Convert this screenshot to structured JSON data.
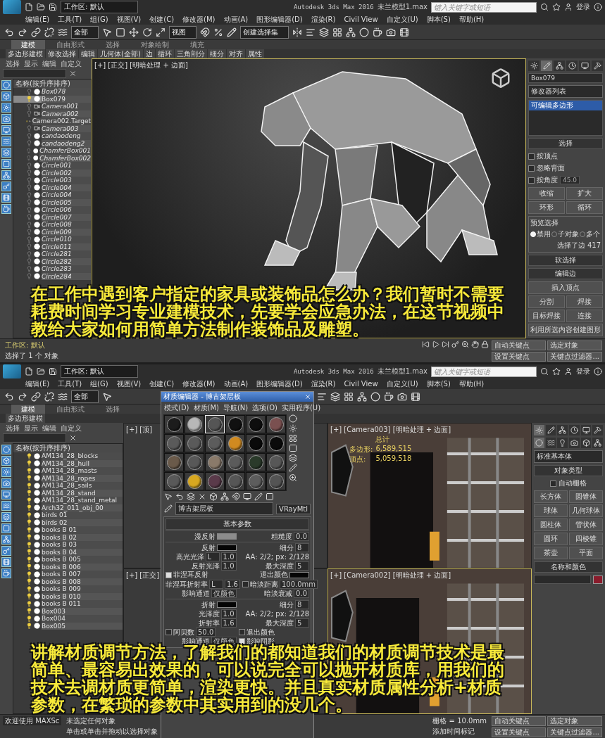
{
  "top": {
    "app": {
      "workspace": "工作区: 默认",
      "title": "Autodesk 3ds Max 2016",
      "file": "未兰模型1.max",
      "search_placeholder": "键入关键字或短语",
      "login": "登录"
    },
    "menu": [
      "编辑(E)",
      "工具(T)",
      "组(G)",
      "视图(V)",
      "创建(C)",
      "修改器(M)",
      "动画(A)",
      "图形编辑器(D)",
      "渲染(R)",
      "Civil View",
      "自定义(U)",
      "脚本(S)",
      "帮助(H)"
    ],
    "toolbar_dropdowns": [
      "全部",
      "视图",
      "创建选择集"
    ],
    "ribbon_tabs": [
      {
        "label": "建模",
        "selected": true
      },
      {
        "label": "自由形式",
        "selected": false
      },
      {
        "label": "选择",
        "selected": false
      },
      {
        "label": "对象绘制",
        "selected": false
      },
      {
        "label": "填充",
        "selected": false
      }
    ],
    "ribbon_items": [
      "多边形建模",
      "修改选择",
      "编辑",
      "几何体(全部)",
      "边",
      "循环",
      "三角剖分",
      "细分",
      "对齐",
      "属性"
    ],
    "explorer": {
      "menu": [
        "选择",
        "显示",
        "编辑",
        "自定义"
      ],
      "header": "名称(按升序排序)",
      "items": [
        {
          "name": "Box078",
          "kind": "object",
          "lit": false,
          "selected": false
        },
        {
          "name": "Box079",
          "kind": "object",
          "lit": true,
          "selected": true
        },
        {
          "name": "Camera001",
          "kind": "camera",
          "lit": false,
          "selected": false
        },
        {
          "name": "Camera002",
          "kind": "camera",
          "lit": false,
          "selected": false
        },
        {
          "name": "Camera002.Target",
          "kind": "camera",
          "lit": true,
          "selected": false
        },
        {
          "name": "Camera003",
          "kind": "camera",
          "lit": false,
          "selected": false
        },
        {
          "name": "candaodeng",
          "kind": "object",
          "lit": false,
          "selected": false
        },
        {
          "name": "candaodeng2",
          "kind": "object",
          "lit": false,
          "selected": false
        },
        {
          "name": "ChamferBox001",
          "kind": "object",
          "lit": false,
          "selected": false
        },
        {
          "name": "ChamferBox002",
          "kind": "object",
          "lit": false,
          "selected": false
        },
        {
          "name": "Circle001",
          "kind": "object",
          "lit": false,
          "selected": false
        },
        {
          "name": "Circle002",
          "kind": "object",
          "lit": false,
          "selected": false
        },
        {
          "name": "Circle003",
          "kind": "object",
          "lit": false,
          "selected": false
        },
        {
          "name": "Circle004",
          "kind": "object",
          "lit": false,
          "selected": false
        },
        {
          "name": "Circle004",
          "kind": "object",
          "lit": false,
          "selected": false
        },
        {
          "name": "Circle005",
          "kind": "object",
          "lit": false,
          "selected": false
        },
        {
          "name": "Circle006",
          "kind": "object",
          "lit": false,
          "selected": false
        },
        {
          "name": "Circle007",
          "kind": "object",
          "lit": false,
          "selected": false
        },
        {
          "name": "Circle008",
          "kind": "object",
          "lit": false,
          "selected": false
        },
        {
          "name": "Circle009",
          "kind": "object",
          "lit": false,
          "selected": false
        },
        {
          "name": "Circle010",
          "kind": "object",
          "lit": false,
          "selected": false
        },
        {
          "name": "Circle011",
          "kind": "object",
          "lit": false,
          "selected": false
        },
        {
          "name": "Circle281",
          "kind": "object",
          "lit": false,
          "selected": false
        },
        {
          "name": "Circle282",
          "kind": "object",
          "lit": false,
          "selected": false
        },
        {
          "name": "Circle283",
          "kind": "object",
          "lit": false,
          "selected": false
        },
        {
          "name": "Circle284",
          "kind": "object",
          "lit": false,
          "selected": false
        }
      ]
    },
    "viewport": {
      "label": "[+] [正交] [明暗处理 + 边面]"
    },
    "command_panel": {
      "object_name": "Box079",
      "modifier_list": "修改器列表",
      "stack": [
        {
          "label": "可编辑多边形",
          "selected": true
        }
      ],
      "selection": {
        "title": "选择",
        "checks": [
          {
            "label": "按顶点",
            "checked": false
          },
          {
            "label": "忽略背面",
            "checked": false
          },
          {
            "label": "按角度",
            "checked": false,
            "value": "45.0"
          }
        ],
        "buttons": [
          "收缩",
          "扩大",
          "环形",
          "循环"
        ],
        "preview": "预览选择",
        "radios": [
          {
            "label": "禁用",
            "selected": true
          },
          {
            "label": "子对象",
            "selected": false
          },
          {
            "label": "多个",
            "selected": false
          }
        ],
        "status": "选择了边 417"
      },
      "soft_selection": "软选择",
      "edit_edges": {
        "title": "编辑边",
        "buttons": [
          "插入顶点",
          "分割",
          "焊接",
          "目标焊接",
          "连接",
          "利用所选内容创建图形"
        ]
      }
    },
    "subtitle": [
      "在工作中遇到客户指定的家具或装饰品怎么办？我们暂时不需要",
      "耗费时间学习专业建模技术，先要学会应急办法，在这节视频中",
      "教给大家如何用简单方法制作装饰品及雕塑。"
    ],
    "status": {
      "left": [
        "工作区: 默认",
        "选择了 1 个 对象"
      ],
      "keys": [
        "自动关键点",
        "选定对象",
        "设置关键点",
        "关键点过滤器..."
      ]
    }
  },
  "bottom": {
    "app": {
      "workspace": "工作区: 默认",
      "title": "Autodesk 3ds Max 2016",
      "file": "未兰模型1.max",
      "search_placeholder": "键入关键字或短语",
      "login": "登录"
    },
    "menu": [
      "编辑(E)",
      "工具(T)",
      "组(G)",
      "视图(V)",
      "创建(C)",
      "修改器(M)",
      "动画(A)",
      "图形编辑器(D)",
      "渲染(R)",
      "Civil View",
      "自定义(U)",
      "脚本(S)",
      "帮助(H)"
    ],
    "toolbar_dropdowns": [
      "全部"
    ],
    "ribbon_tabs": [
      {
        "label": "建模",
        "selected": true
      },
      {
        "label": "自由形式",
        "selected": false
      },
      {
        "label": "选择",
        "selected": false
      }
    ],
    "ribbon_items": [
      "多边形建模"
    ],
    "explorer": {
      "menu": [
        "选择",
        "显示",
        "编辑",
        "自定义"
      ],
      "header": "名称(按升序排序)",
      "items": [
        {
          "name": "AM134_28_blocks",
          "kind": "object",
          "lit": true,
          "selected": false
        },
        {
          "name": "AM134_28_hull",
          "kind": "object",
          "lit": true,
          "selected": false
        },
        {
          "name": "AM134_28_masts",
          "kind": "object",
          "lit": true,
          "selected": false
        },
        {
          "name": "AM134_28_ropes",
          "kind": "object",
          "lit": true,
          "selected": false
        },
        {
          "name": "AM134_28_sails",
          "kind": "object",
          "lit": true,
          "selected": false
        },
        {
          "name": "AM134_28_stand",
          "kind": "object",
          "lit": true,
          "selected": false
        },
        {
          "name": "AM134_28_stand_metal",
          "kind": "object",
          "lit": true,
          "selected": false
        },
        {
          "name": "Arch32_011_obj_00",
          "kind": "object",
          "lit": true,
          "selected": false
        },
        {
          "name": "birds 01",
          "kind": "object",
          "lit": true,
          "selected": false
        },
        {
          "name": "birds 02",
          "kind": "object",
          "lit": true,
          "selected": false
        },
        {
          "name": "books B 01",
          "kind": "object",
          "lit": true,
          "selected": false
        },
        {
          "name": "books B 02",
          "kind": "object",
          "lit": true,
          "selected": false
        },
        {
          "name": "books B 03",
          "kind": "object",
          "lit": true,
          "selected": false
        },
        {
          "name": "books B 04",
          "kind": "object",
          "lit": true,
          "selected": false
        },
        {
          "name": "books B 005",
          "kind": "object",
          "lit": true,
          "selected": false
        },
        {
          "name": "books B 006",
          "kind": "object",
          "lit": true,
          "selected": false
        },
        {
          "name": "books B 007",
          "kind": "object",
          "lit": true,
          "selected": false
        },
        {
          "name": "books B 008",
          "kind": "object",
          "lit": true,
          "selected": false
        },
        {
          "name": "books B 009",
          "kind": "object",
          "lit": true,
          "selected": false
        },
        {
          "name": "books B 010",
          "kind": "object",
          "lit": true,
          "selected": false
        },
        {
          "name": "books B 011",
          "kind": "object",
          "lit": true,
          "selected": false
        },
        {
          "name": "Box003",
          "kind": "object",
          "lit": true,
          "selected": false
        },
        {
          "name": "Box004",
          "kind": "object",
          "lit": true,
          "selected": false
        },
        {
          "name": "Box005",
          "kind": "object",
          "lit": true,
          "selected": false
        }
      ]
    },
    "side_viewports": [
      "[+] [顶]",
      "[+] [正交]"
    ],
    "camera_viewports": [
      {
        "label": "[+] [Camera003] [明暗处理 + 边面]",
        "stats": {
          "title": "总计",
          "rows": [
            [
              "多边形:",
              "6,589,515"
            ],
            [
              "顶点:",
              "5,059,518"
            ]
          ]
        }
      },
      {
        "label": "[+] [Camera002] [明暗处理 + 边面]"
      }
    ],
    "material_editor": {
      "title": "材质编辑器 - 博古架层板",
      "menu": [
        "模式(D)",
        "材质(M)",
        "导航(N)",
        "选项(O)",
        "实用程序(U)"
      ],
      "slots": [
        {
          "color": "#1c1c1c",
          "selected": false
        },
        {
          "color": "#b8b8b8",
          "selected": false
        },
        {
          "color": "#555555",
          "selected": true
        },
        {
          "color": "#111111",
          "selected": false
        },
        {
          "color": "#0e0e0e",
          "selected": false
        },
        {
          "color": "#7a5050",
          "selected": false
        },
        {
          "color": "#5a5a5a",
          "selected": false
        },
        {
          "color": "#5a5a5a",
          "selected": false
        },
        {
          "color": "#5c5c5c",
          "selected": false
        },
        {
          "color": "#d08a20",
          "selected": false
        },
        {
          "color": "#0a0a0a",
          "selected": false
        },
        {
          "color": "#0b0b0b",
          "selected": false
        },
        {
          "color": "#6a5a4a",
          "selected": false
        },
        {
          "color": "#585858",
          "selected": false
        },
        {
          "color": "#8a7a6a",
          "selected": false
        },
        {
          "color": "#5b5b5b",
          "selected": false
        },
        {
          "color": "#2a3a2a",
          "selected": false
        },
        {
          "color": "#575757",
          "selected": false
        },
        {
          "color": "#595959",
          "selected": false
        },
        {
          "color": "#d8a820",
          "selected": false
        },
        {
          "color": "#5a3a4a",
          "selected": false
        },
        {
          "color": "#565656",
          "selected": false
        },
        {
          "color": "#5d5d5d",
          "selected": false
        },
        {
          "color": "#545454",
          "selected": false
        }
      ],
      "material_name": "博古架层板",
      "material_type": "VRayMtl",
      "rollout": "基本参数",
      "sections": [
        [
          [
            {
              "kind": "swatch",
              "label": "漫反射",
              "color": "#8c8c8c"
            },
            {
              "kind": "field",
              "label": "粗糙度",
              "value": "0.0"
            }
          ]
        ],
        [
          [
            {
              "kind": "swatch",
              "label": "反射",
              "color": "#050505"
            },
            {
              "kind": "field",
              "label": "细分",
              "value": "8"
            }
          ],
          [
            {
              "kind": "field",
              "label": "高光光泽",
              "prefix": "L",
              "value": "1.0"
            },
            {
              "kind": "text",
              "label": "AA: 2/2; px: 2/128"
            }
          ],
          [
            {
              "kind": "field",
              "label": "反射光泽",
              "value": "1.0"
            },
            {
              "kind": "field",
              "label": "最大深度",
              "value": "5"
            }
          ],
          [
            {
              "kind": "check",
              "label": "菲涅耳反射",
              "checked": true
            },
            {
              "kind": "swatch",
              "label": "退出颜色",
              "color": "#050505"
            }
          ],
          [
            {
              "kind": "field",
              "label": "菲涅耳折射率",
              "prefix": "L",
              "value": "1.6"
            },
            {
              "kind": "check",
              "label": "暗淡距离",
              "checked": false,
              "value": "100.0mm"
            }
          ],
          [
            {
              "kind": "dropdown",
              "label": "影响通道",
              "value": "仅颜色"
            },
            {
              "kind": "field",
              "label": "暗淡衰减",
              "value": "0.0"
            }
          ]
        ],
        [
          [
            {
              "kind": "swatch",
              "label": "折射",
              "color": "#050505"
            },
            {
              "kind": "field",
              "label": "细分",
              "value": "8"
            }
          ],
          [
            {
              "kind": "field",
              "label": "光泽度",
              "value": "1.0"
            },
            {
              "kind": "text",
              "label": "AA: 2/2; px: 2/128"
            }
          ],
          [
            {
              "kind": "field",
              "label": "折射率",
              "value": "1.6"
            },
            {
              "kind": "field",
              "label": "最大深度",
              "value": "5"
            }
          ],
          [
            {
              "kind": "check",
              "label": "阿贝数",
              "checked": false,
              "value": "50.0"
            },
            {
              "kind": "check",
              "label": "退出颜色",
              "checked": false
            }
          ],
          [
            {
              "kind": "dropdown",
              "label": "影响通道",
              "value": "仅颜色"
            },
            {
              "kind": "check",
              "label": "影响阴影",
              "checked": true
            }
          ]
        ]
      ]
    },
    "command_panel": {
      "category": "标准基本体",
      "object_type": "对象类型",
      "autogrid": {
        "label": "自动栅格",
        "checked": false
      },
      "buttons": [
        "长方体",
        "圆锥体",
        "球体",
        "几何球体",
        "圆柱体",
        "管状体",
        "圆环",
        "四棱锥",
        "茶壶",
        "平面"
      ],
      "name_color": "名称和颜色"
    },
    "subtitle": [
      "讲解材质调节方法，了解我们的都知道我们的材质调节技术是最",
      "简单、最容易出效果的，可以说完全可以抛开材质库，用我们的",
      "技术去调材质更简单，渲染更快。并且真实材质属性分析+材质",
      "参数，在繁琐的参数中其实用到的没几个。"
    ],
    "status": {
      "left": [
        "欢迎使用 MAXSc",
        "未选定任何对象",
        "单击或单击并拖动以选择对象"
      ],
      "grid": "栅格 = 10.0mm",
      "time_tag": "添加时间标记",
      "keys": [
        "自动关键点",
        "选定对象",
        "设置关键点",
        "关键点过滤器..."
      ]
    }
  }
}
